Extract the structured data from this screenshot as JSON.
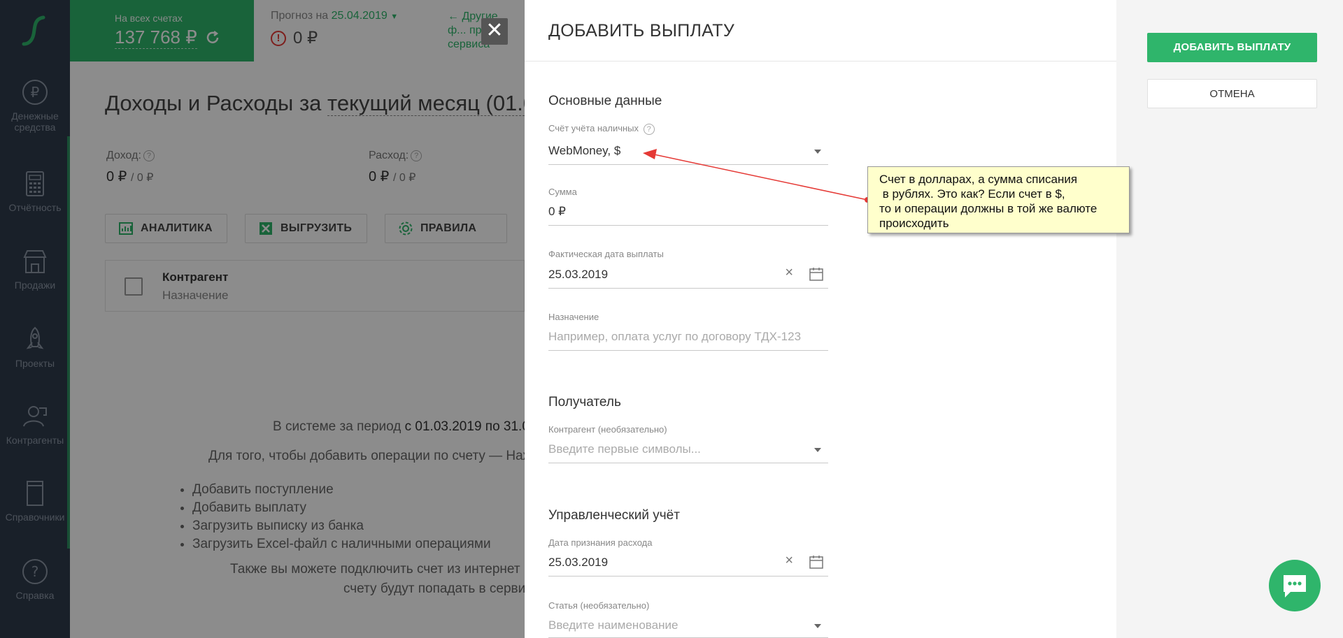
{
  "sidebar": {
    "items": [
      {
        "label": "Денежные средства",
        "icon": "ruble-icon"
      },
      {
        "label": "Отчётность",
        "icon": "calculator-icon"
      },
      {
        "label": "Продажи",
        "icon": "shop-icon"
      },
      {
        "label": "Проекты",
        "icon": "rocket-icon"
      },
      {
        "label": "Контрагенты",
        "icon": "people-icon"
      },
      {
        "label": "Справочники",
        "icon": "book-icon"
      },
      {
        "label": "Справка",
        "icon": "help-icon"
      }
    ]
  },
  "header": {
    "balance_label": "На всех счетах",
    "balance_value": "137 768 ₽",
    "forecast_label": "Прогноз на",
    "forecast_date": "25.04.2019",
    "forecast_value": "0 ₽",
    "other_link": "← Другие ф... пр... сервиса"
  },
  "main": {
    "title_prefix": "Доходы и Расходы за",
    "title_period": "текущий месяц (01.0",
    "income_label": "Доход:",
    "income_value": "0 ₽",
    "income_sub": "/ 0 ₽",
    "expense_label": "Расход:",
    "expense_value": "0 ₽",
    "expense_sub": "/ 0 ₽",
    "buttons": {
      "analytics": "АНАЛИТИКА",
      "export": "ВЫГРУЗИТЬ",
      "rules": "ПРАВИЛА"
    },
    "table_col1": "Контрагент",
    "table_col2": "Назначение",
    "empty_line1_prefix": "В системе за период",
    "empty_line1_bold": "с 01.03.2019 по 31.0",
    "empty_line2": "Для того, чтобы добавить операции по счету — Наж",
    "empty_list": [
      "Добавить поступление",
      "Добавить выплату",
      "Загрузить выписку из банка",
      "Загрузить Excel-файл с наличными операциями"
    ],
    "empty_line3": "Также вы можете подключить счет из интернет",
    "empty_line4": "счету будут попадать в серви"
  },
  "drawer": {
    "title": "ДОБАВИТЬ ВЫПЛАТУ",
    "section_main": "Основные данные",
    "account_label": "Счёт учёта наличных",
    "account_value": "WebMoney, $",
    "amount_label": "Сумма",
    "amount_value": "0 ₽",
    "date_label": "Фактическая дата выплаты",
    "date_value": "25.03.2019",
    "purpose_label": "Назначение",
    "purpose_placeholder": "Например, оплата услуг по договору ТДХ-123",
    "section_recipient": "Получатель",
    "counterparty_label": "Контрагент (необязательно)",
    "counterparty_placeholder": "Введите первые символы...",
    "section_mgmt": "Управленческий учёт",
    "recognition_label": "Дата признания расхода",
    "recognition_value": "25.03.2019",
    "article_label": "Статья (необязательно)",
    "article_placeholder": "Введите наименование"
  },
  "actions": {
    "add_button": "ДОБАВИТЬ ВЫПЛАТУ",
    "cancel_button": "ОТМЕНА"
  },
  "annotation": {
    "text": "Счет в долларах, а сумма списания\n в рублях. Это как? Если счет в $,\nто и операции должны в той же валюте\nпроисходить"
  },
  "colors": {
    "accent": "#2fb56b",
    "sidebar": "#2f3b4b",
    "note": "#ffffcc",
    "arrow": "#e53935"
  }
}
